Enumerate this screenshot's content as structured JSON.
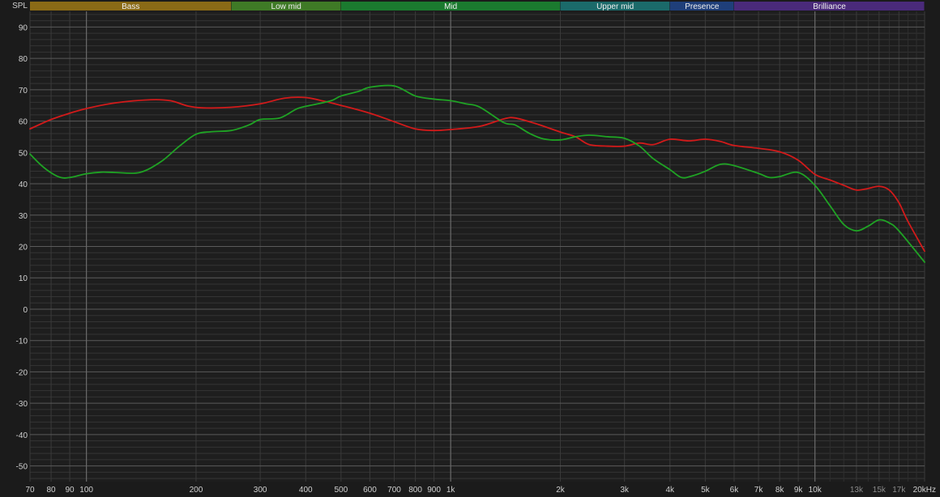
{
  "chart_data": {
    "type": "line",
    "ylabel": "SPL",
    "xscale": "log",
    "xlim": [
      70,
      20000
    ],
    "ylim": [
      -55,
      95
    ],
    "grid": true,
    "colors": {
      "background": "#1b1b1b",
      "plot_background": "#1e1e1e",
      "major_grid": "#5a5a5a",
      "minor_grid": "#343434"
    },
    "bands": [
      {
        "label": "Bass",
        "from": 70,
        "to": 250,
        "color": "#8a6a16"
      },
      {
        "label": "Low mid",
        "from": 250,
        "to": 500,
        "color": "#3f7a26"
      },
      {
        "label": "Mid",
        "from": 500,
        "to": 2000,
        "color": "#1b7a2f"
      },
      {
        "label": "Upper mid",
        "from": 2000,
        "to": 4000,
        "color": "#1b6a6a"
      },
      {
        "label": "Presence",
        "from": 4000,
        "to": 6000,
        "color": "#1f3f7a"
      },
      {
        "label": "Brilliance",
        "from": 6000,
        "to": 20000,
        "color": "#4a2a7a"
      }
    ],
    "y_ticks": [
      "90",
      "80",
      "70",
      "60",
      "50",
      "40",
      "30",
      "20",
      "10",
      "0",
      "-10",
      "-20",
      "-30",
      "-40",
      "-50"
    ],
    "x_ticks": [
      {
        "v": 70,
        "label": "70"
      },
      {
        "v": 80,
        "label": "80"
      },
      {
        "v": 90,
        "label": "90"
      },
      {
        "v": 100,
        "label": "100"
      },
      {
        "v": 200,
        "label": "200"
      },
      {
        "v": 300,
        "label": "300"
      },
      {
        "v": 400,
        "label": "400"
      },
      {
        "v": 500,
        "label": "500"
      },
      {
        "v": 600,
        "label": "600"
      },
      {
        "v": 700,
        "label": "700"
      },
      {
        "v": 800,
        "label": "800"
      },
      {
        "v": 900,
        "label": "900"
      },
      {
        "v": 1000,
        "label": "1k"
      },
      {
        "v": 2000,
        "label": "2k"
      },
      {
        "v": 3000,
        "label": "3k"
      },
      {
        "v": 4000,
        "label": "4k"
      },
      {
        "v": 5000,
        "label": "5k"
      },
      {
        "v": 6000,
        "label": "6k"
      },
      {
        "v": 7000,
        "label": "7k"
      },
      {
        "v": 8000,
        "label": "8k"
      },
      {
        "v": 9000,
        "label": "9k"
      },
      {
        "v": 10000,
        "label": "10k"
      },
      {
        "v": 13000,
        "label": "13k",
        "dim": true
      },
      {
        "v": 15000,
        "label": "15k",
        "dim": true
      },
      {
        "v": 17000,
        "label": "17k",
        "dim": true
      },
      {
        "v": 20000,
        "label": "20kHz"
      }
    ],
    "series": [
      {
        "color": "#d21a1a",
        "points": [
          [
            70,
            57.5
          ],
          [
            80,
            60.5
          ],
          [
            90,
            62.5
          ],
          [
            100,
            64
          ],
          [
            120,
            65.8
          ],
          [
            150,
            66.8
          ],
          [
            170,
            66.5
          ],
          [
            190,
            64.8
          ],
          [
            210,
            64.2
          ],
          [
            250,
            64.4
          ],
          [
            300,
            65.5
          ],
          [
            350,
            67.3
          ],
          [
            400,
            67.5
          ],
          [
            450,
            66.3
          ],
          [
            500,
            65
          ],
          [
            600,
            62.5
          ],
          [
            700,
            59.8
          ],
          [
            800,
            57.5
          ],
          [
            900,
            57
          ],
          [
            1000,
            57.3
          ],
          [
            1200,
            58.3
          ],
          [
            1400,
            60.7
          ],
          [
            1500,
            61
          ],
          [
            1700,
            59.3
          ],
          [
            2000,
            56.5
          ],
          [
            2200,
            55
          ],
          [
            2400,
            52.5
          ],
          [
            2700,
            52
          ],
          [
            3000,
            52
          ],
          [
            3300,
            53
          ],
          [
            3600,
            52.5
          ],
          [
            4000,
            54.2
          ],
          [
            4500,
            53.7
          ],
          [
            5000,
            54.2
          ],
          [
            5500,
            53.5
          ],
          [
            6000,
            52.2
          ],
          [
            7000,
            51.3
          ],
          [
            8000,
            50.2
          ],
          [
            9000,
            47.5
          ],
          [
            10000,
            43
          ],
          [
            11000,
            41.2
          ],
          [
            12000,
            39.5
          ],
          [
            13000,
            38
          ],
          [
            14000,
            38.5
          ],
          [
            15000,
            39.2
          ],
          [
            16000,
            38
          ],
          [
            17000,
            34
          ],
          [
            18000,
            28
          ],
          [
            20000,
            18.5
          ]
        ]
      },
      {
        "color": "#1fa324",
        "points": [
          [
            70,
            49.5
          ],
          [
            75,
            46
          ],
          [
            80,
            43.5
          ],
          [
            85,
            42
          ],
          [
            90,
            42
          ],
          [
            100,
            43.2
          ],
          [
            110,
            43.7
          ],
          [
            120,
            43.6
          ],
          [
            140,
            43.6
          ],
          [
            160,
            47
          ],
          [
            180,
            52
          ],
          [
            200,
            55.8
          ],
          [
            220,
            56.6
          ],
          [
            250,
            57
          ],
          [
            280,
            58.8
          ],
          [
            300,
            60.5
          ],
          [
            340,
            61
          ],
          [
            380,
            64
          ],
          [
            420,
            65.2
          ],
          [
            470,
            66.5
          ],
          [
            500,
            68
          ],
          [
            560,
            69.5
          ],
          [
            600,
            70.8
          ],
          [
            700,
            71.2
          ],
          [
            800,
            68
          ],
          [
            900,
            67
          ],
          [
            1000,
            66.5
          ],
          [
            1100,
            65.5
          ],
          [
            1200,
            64.5
          ],
          [
            1400,
            59.5
          ],
          [
            1500,
            58.8
          ],
          [
            1650,
            56
          ],
          [
            1800,
            54.3
          ],
          [
            2000,
            54
          ],
          [
            2200,
            55
          ],
          [
            2400,
            55.5
          ],
          [
            2700,
            55
          ],
          [
            3000,
            54.5
          ],
          [
            3300,
            52
          ],
          [
            3600,
            48
          ],
          [
            4000,
            44.5
          ],
          [
            4300,
            42
          ],
          [
            4600,
            42.5
          ],
          [
            5000,
            44
          ],
          [
            5500,
            46.2
          ],
          [
            6000,
            45.8
          ],
          [
            7000,
            43.3
          ],
          [
            7500,
            42
          ],
          [
            8000,
            42.3
          ],
          [
            9000,
            43.6
          ],
          [
            10000,
            39.5
          ],
          [
            11000,
            33
          ],
          [
            12000,
            27
          ],
          [
            13000,
            25
          ],
          [
            14000,
            26.5
          ],
          [
            15000,
            28.5
          ],
          [
            16000,
            27.5
          ],
          [
            17000,
            25
          ],
          [
            20000,
            15
          ]
        ]
      }
    ]
  }
}
